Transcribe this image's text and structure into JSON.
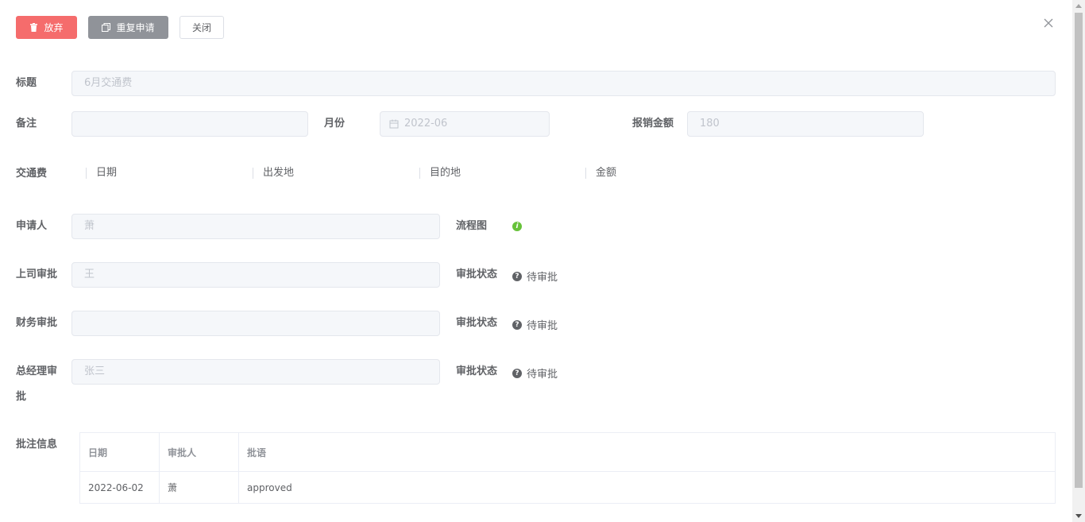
{
  "toolbar": {
    "abandon_label": "放弃",
    "reapply_label": "重复申请",
    "close_label": "关闭"
  },
  "form": {
    "title": {
      "label": "标题",
      "value": "6月交通费"
    },
    "remark": {
      "label": "备注",
      "value": ""
    },
    "month": {
      "label": "月份",
      "value": "2022-06"
    },
    "amount": {
      "label": "报销金额",
      "value": "180"
    },
    "transport": {
      "label": "交通费",
      "columns": [
        "日期",
        "出发地",
        "目的地",
        "金额"
      ]
    },
    "applicant": {
      "label": "申请人",
      "value": "萧"
    },
    "flowchart": {
      "label": "流程图"
    },
    "approvals": [
      {
        "label": "上司审批",
        "value": "王",
        "status_label": "审批状态",
        "status": "待审批"
      },
      {
        "label": "财务审批",
        "value": "",
        "status_label": "审批状态",
        "status": "待审批"
      },
      {
        "label_line1": "总经理审",
        "label_line2": "批",
        "value": "张三",
        "status_label": "审批状态",
        "status": "待审批"
      }
    ],
    "notes": {
      "label": "批注信息",
      "headers": [
        "日期",
        "审批人",
        "批语"
      ],
      "rows": [
        [
          "2022-06-02",
          "萧",
          "approved"
        ]
      ]
    }
  },
  "colors": {
    "danger": "#f56c6c",
    "info": "#909399",
    "success": "#67c23a"
  },
  "icons": {
    "abandon": "trash-icon",
    "reapply": "copy-icon",
    "close": "close-icon",
    "month": "calendar-icon",
    "flowchart": "info-icon",
    "status": "question-icon"
  }
}
